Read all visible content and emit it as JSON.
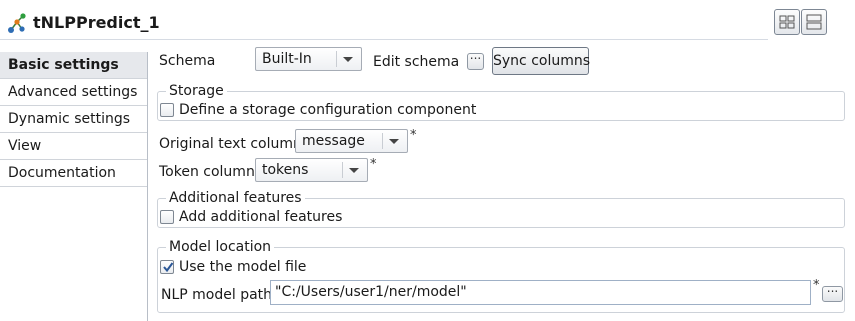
{
  "header": {
    "title": "tNLPPredict_1",
    "icon": "nlp-tree-icon",
    "layout_buttons": [
      "grid-layout-icon",
      "split-layout-icon"
    ]
  },
  "sidebar": {
    "items": [
      {
        "label": "Basic settings",
        "active": true
      },
      {
        "label": "Advanced settings",
        "active": false
      },
      {
        "label": "Dynamic settings",
        "active": false
      },
      {
        "label": "View",
        "active": false
      },
      {
        "label": "Documentation",
        "active": false
      }
    ]
  },
  "main": {
    "schema": {
      "label": "Schema",
      "value": "Built-In",
      "edit_label": "Edit schema",
      "edit_button_text": "...",
      "sync_label": "Sync columns"
    },
    "storage": {
      "title": "Storage",
      "checkbox_label": "Define a storage configuration component",
      "checked": false
    },
    "original_text": {
      "label": "Original text column",
      "value": "message",
      "required_mark": "*"
    },
    "token": {
      "label": "Token column",
      "value": "tokens",
      "required_mark": "*"
    },
    "additional": {
      "title": "Additional features",
      "checkbox_label": "Add additional features",
      "checked": false
    },
    "model": {
      "title": "Model location",
      "checkbox_label": "Use the model file",
      "checked": true,
      "path_label": "NLP model path",
      "path_value": "\"C:/Users/user1/ner/model\"",
      "required_mark": "*",
      "browse_button_text": "..."
    }
  },
  "colors": {
    "active_tab_bg": "#e6e8ec",
    "border": "#cdd2d9",
    "checkmark": "#2b5797"
  }
}
